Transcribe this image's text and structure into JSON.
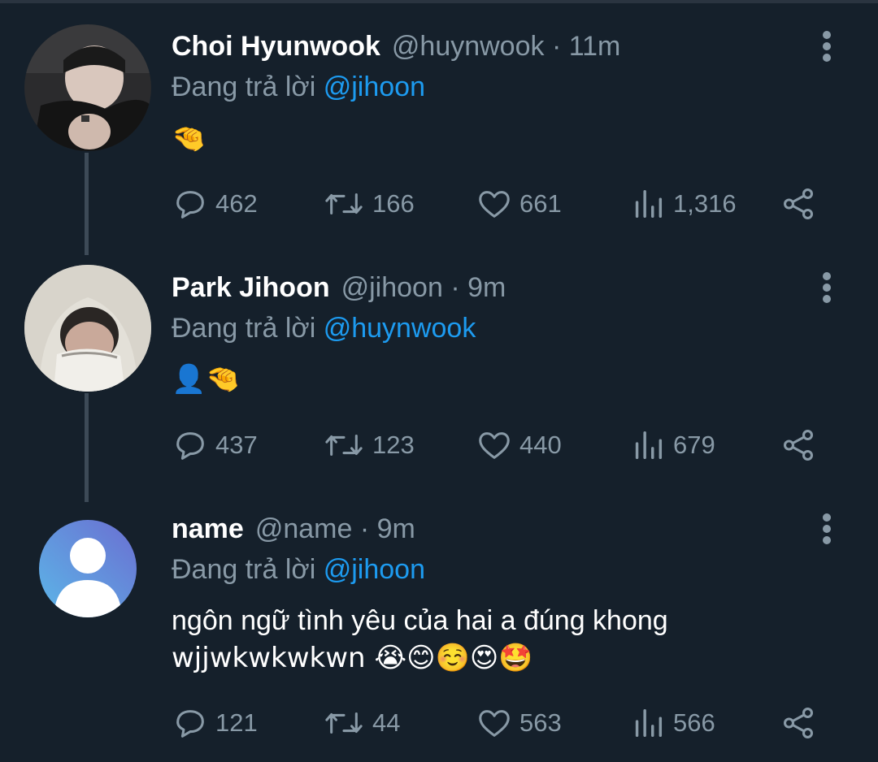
{
  "tweets": [
    {
      "name": "Choi Hyunwook",
      "handle": "@huynwook · 11m",
      "reply_prefix": "Đang trả lời",
      "reply_to": "@jihoon",
      "content": "🤏",
      "stats": {
        "replies": "462",
        "retweets": "166",
        "likes": "661",
        "views": "1,316"
      }
    },
    {
      "name": "Park Jihoon",
      "handle": "@jihoon · 9m",
      "reply_prefix": "Đang trả lời",
      "reply_to": "@huynwook",
      "content": "👤🤏",
      "stats": {
        "replies": "437",
        "retweets": "123",
        "likes": "440",
        "views": "679"
      }
    },
    {
      "name": "name",
      "handle": "@name · 9m",
      "reply_prefix": "Đang trả lời",
      "reply_to": "@jihoon",
      "content_line1": "ngôn ngữ tình yêu của hai a đúng khong",
      "content_line2": "wjjwkwkwkwn 😭😊☺️😍🤩",
      "stats": {
        "replies": "121",
        "retweets": "44",
        "likes": "563",
        "views": "566"
      }
    }
  ],
  "colors": {
    "background": "#15202b",
    "secondary_text": "#8899a6",
    "mention": "#1d9bf0",
    "thread_line": "#3d4a57"
  },
  "icons": [
    "reply-icon",
    "retweet-icon",
    "like-icon",
    "views-icon",
    "share-icon",
    "more-icon"
  ]
}
